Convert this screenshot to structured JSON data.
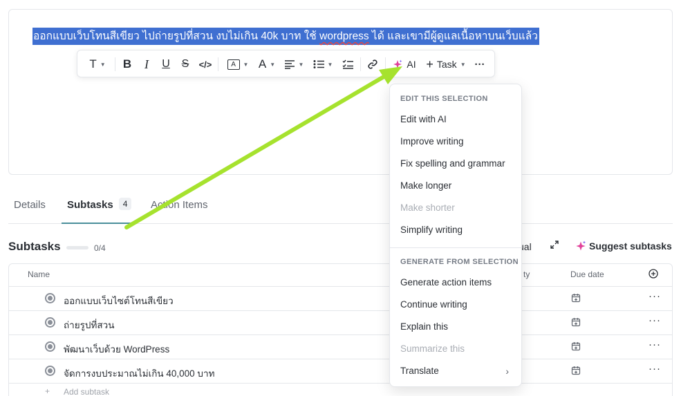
{
  "editor": {
    "selected_text_before": "ออกแบบเว็บโทนสีเขียว ไปถ่ายรูปที่สวน งบไม่เกิน 40k บาท ใช้ ",
    "selected_text_link": "wordpress",
    "selected_text_after": " ได้ และเขามีผู้ดูแลเนื้อหาบนเว็บแล้ว"
  },
  "toolbar": {
    "text_style": "T",
    "bold": "B",
    "italic": "I",
    "underline": "U",
    "strike": "S",
    "code": "</>",
    "box_a": "A",
    "text_color": "A",
    "ai_label": "AI",
    "task_label": "Task",
    "more": "···"
  },
  "tabs": {
    "details": "Details",
    "subtasks": "Subtasks",
    "subtasks_count": "4",
    "action_items": "Action Items"
  },
  "subtasks": {
    "title": "Subtasks",
    "progress_text": "0/4",
    "progress_fraction": 0,
    "partial_manual": "ual",
    "suggest_label": "Suggest subtasks",
    "columns": {
      "name": "Name",
      "priority_partial": "ty",
      "due_date": "Due date"
    },
    "rows": [
      {
        "name": "ออกแบบเว็บไซต์โทนสีเขียว"
      },
      {
        "name": "ถ่ายรูปที่สวน"
      },
      {
        "name": "พัฒนาเว็บด้วย WordPress"
      },
      {
        "name": "จัดการงบประมาณไม่เกิน 40,000 บาท"
      }
    ],
    "add_subtask": "Add subtask"
  },
  "ai_menu": {
    "section_edit": "EDIT THIS SELECTION",
    "edit_items": [
      {
        "label": "Edit with AI",
        "disabled": false
      },
      {
        "label": "Improve writing",
        "disabled": false
      },
      {
        "label": "Fix spelling and grammar",
        "disabled": false
      },
      {
        "label": "Make longer",
        "disabled": false
      },
      {
        "label": "Make shorter",
        "disabled": true
      },
      {
        "label": "Simplify writing",
        "disabled": false
      }
    ],
    "section_generate": "GENERATE FROM SELECTION",
    "generate_items": [
      {
        "label": "Generate action items",
        "disabled": false
      },
      {
        "label": "Continue writing",
        "disabled": false
      },
      {
        "label": "Explain this",
        "disabled": false
      },
      {
        "label": "Summarize this",
        "disabled": true
      },
      {
        "label": "Translate",
        "disabled": false
      }
    ]
  },
  "colors": {
    "selection": "#3f6fd1",
    "annotation_arrow": "#a6e22e",
    "ai_sparkle": "#e0409a",
    "tab_underline": "#4a8f9a"
  }
}
